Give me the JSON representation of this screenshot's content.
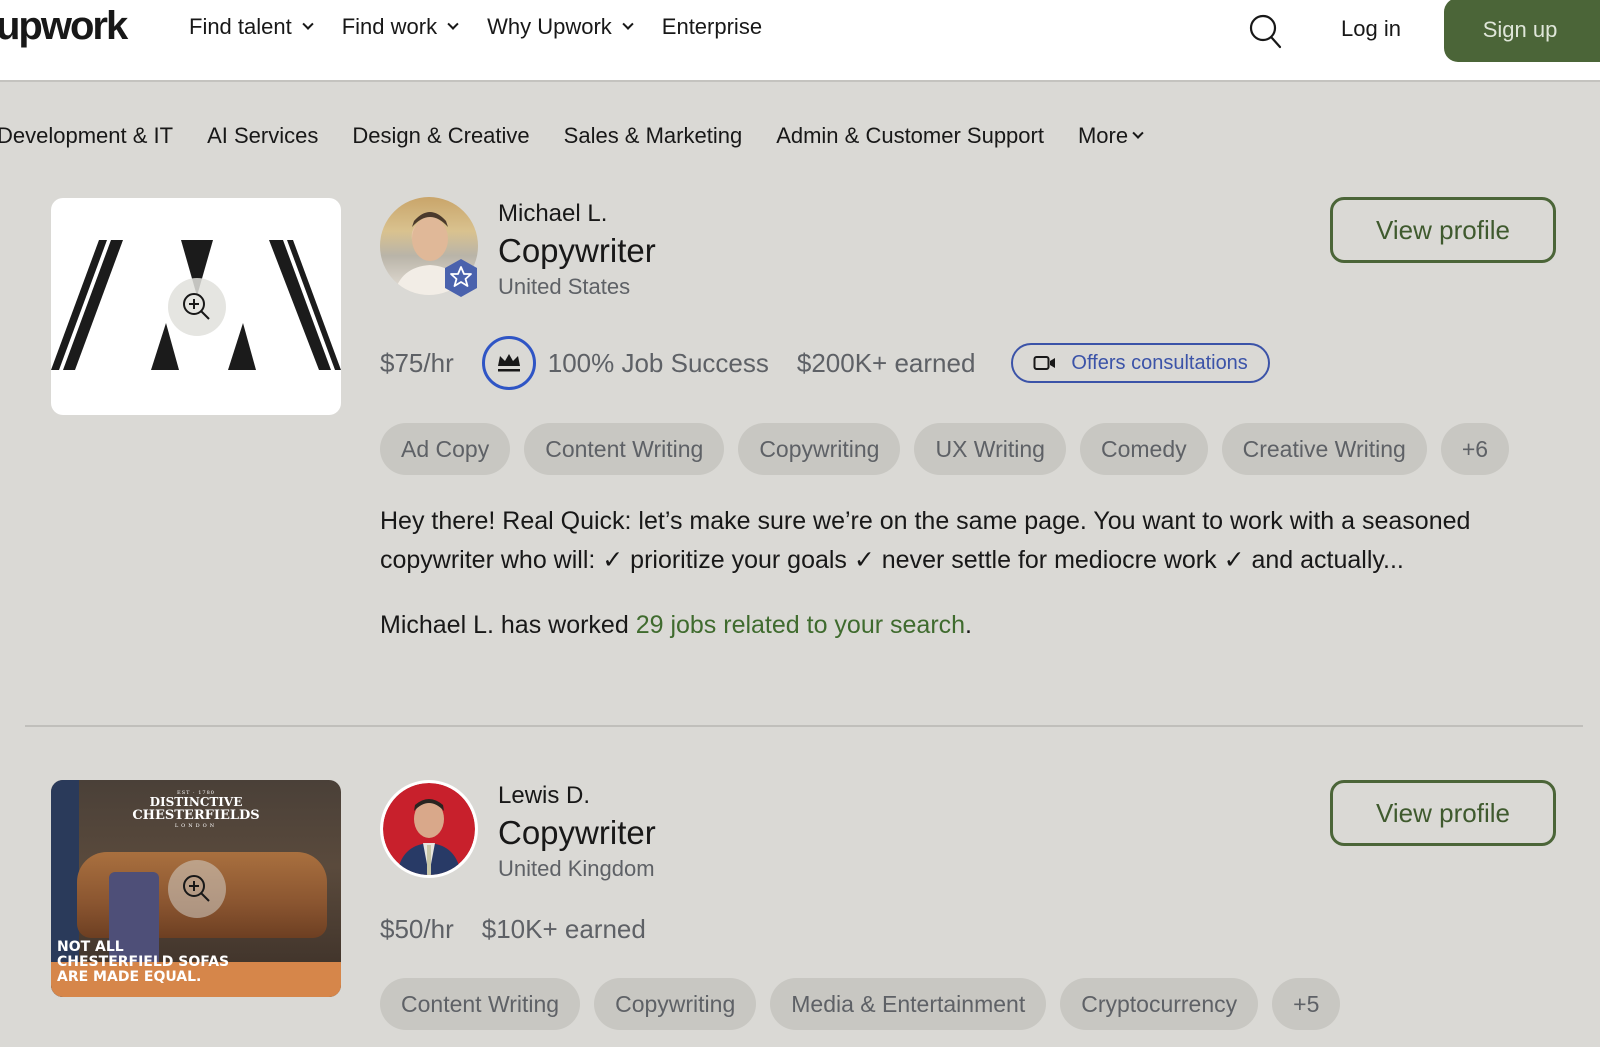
{
  "header": {
    "logo": "upwork",
    "nav": [
      {
        "label": "Find talent",
        "has_dropdown": true
      },
      {
        "label": "Find work",
        "has_dropdown": true
      },
      {
        "label": "Why Upwork",
        "has_dropdown": true
      },
      {
        "label": "Enterprise",
        "has_dropdown": false
      }
    ],
    "search_icon": "search-icon",
    "login_label": "Log in",
    "signup_label": "Sign up",
    "brand_color": "#4b6538"
  },
  "categories": {
    "items": [
      "Development & IT",
      "AI Services",
      "Design & Creative",
      "Sales & Marketing",
      "Admin & Customer Support"
    ],
    "more_label": "More"
  },
  "freelancers": [
    {
      "name": "Michael L.",
      "title": "Copywriter",
      "country": "United States",
      "view_profile_label": "View profile",
      "rate": "$75/hr",
      "job_success": "100% Job Success",
      "earned": "$200K+ earned",
      "consultation_label": "Offers consultations",
      "skills": [
        "Ad Copy",
        "Content Writing",
        "Copywriting",
        "UX Writing",
        "Comedy",
        "Creative Writing"
      ],
      "more_skills": "+6",
      "description_line1": "Hey there! Real Quick: let’s make sure we’re on the same page. You want to work with a seasoned",
      "description_line2": "copywriter who will: ✓ prioritize your goals ✓ never settle for mediocre work ✓ and actually...",
      "related_prefix": "Michael L. has worked ",
      "related_link": "29 jobs related to your search",
      "related_suffix": ".",
      "badge": "top-rated-plus-star-icon"
    },
    {
      "name": "Lewis D.",
      "title": "Copywriter",
      "country": "United Kingdom",
      "view_profile_label": "View profile",
      "rate": "$50/hr",
      "earned": "$10K+ earned",
      "skills": [
        "Content Writing",
        "Copywriting",
        "Media & Entertainment",
        "Cryptocurrency"
      ],
      "more_skills": "+5",
      "portfolio": {
        "est": "EST · 1780",
        "brand_line1": "DISTINCTIVE",
        "brand_line2": "CHESTERFIELDS",
        "brand_line3": "LONDON",
        "tagline1": "NOT ALL",
        "tagline2": "CHESTERFIELD SOFAS",
        "tagline3": "ARE MADE EQUAL."
      }
    }
  ]
}
